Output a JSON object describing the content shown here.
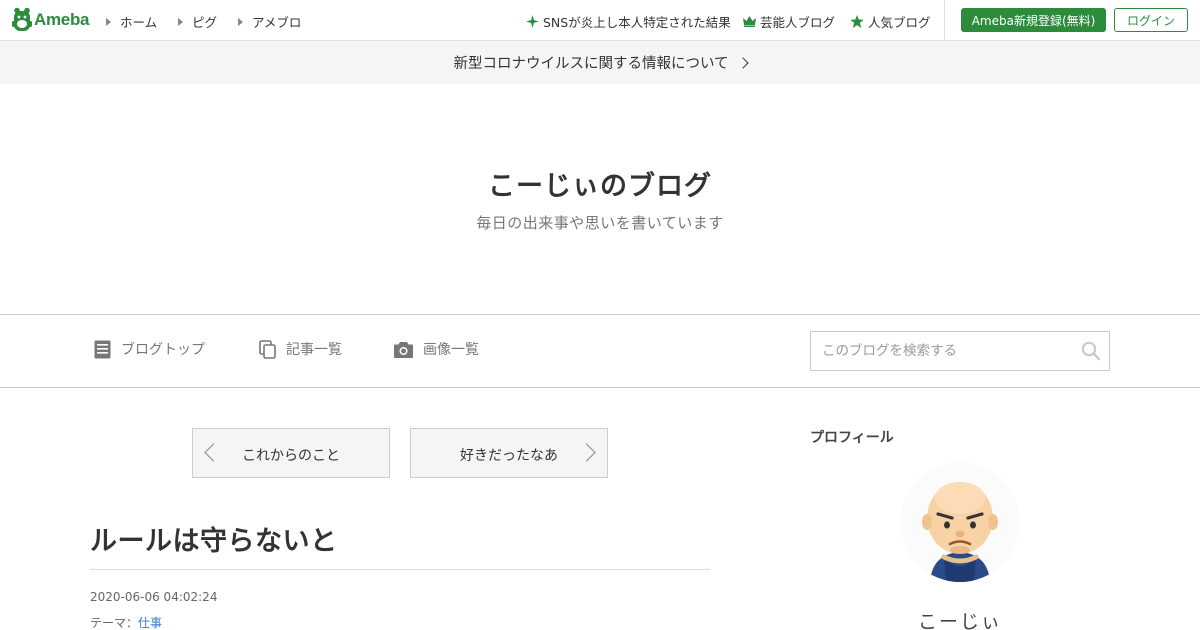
{
  "brand": {
    "logo_text": "Ameba",
    "accent": "#2d8c3c"
  },
  "topnav": {
    "links": [
      {
        "label": "ホーム",
        "icon": "triangle-right-icon"
      },
      {
        "label": "ピグ",
        "icon": "triangle-right-icon"
      },
      {
        "label": "アメブロ",
        "icon": "triangle-right-icon"
      }
    ],
    "promos": [
      {
        "label": "SNSが炎上し本人特定された結果",
        "icon": "sparkle-icon"
      },
      {
        "label": "芸能人ブログ",
        "icon": "crown-icon"
      },
      {
        "label": "人気ブログ",
        "icon": "star-icon"
      }
    ],
    "register_label": "Ameba新規登録(無料)",
    "login_label": "ログイン"
  },
  "notice": {
    "text": "新型コロナウイルスに関する情報について"
  },
  "blog": {
    "title": "こーじぃのブログ",
    "description": "毎日の出来事や思いを書いています"
  },
  "blognav": {
    "items": [
      {
        "label": "ブログトップ",
        "icon": "document-icon"
      },
      {
        "label": "記事一覧",
        "icon": "copy-icon"
      },
      {
        "label": "画像一覧",
        "icon": "camera-icon"
      }
    ],
    "search_placeholder": "このブログを検索する"
  },
  "pager": {
    "prev_label": "これからのこと",
    "next_label": "好きだったなあ"
  },
  "article": {
    "title": "ルールは守らないと",
    "date": "2020-06-06 04:02:24",
    "theme_prefix": "テーマ：",
    "theme": "仕事"
  },
  "sidebar": {
    "profile_heading": "プロフィール",
    "profile_name": "こーじぃ"
  }
}
